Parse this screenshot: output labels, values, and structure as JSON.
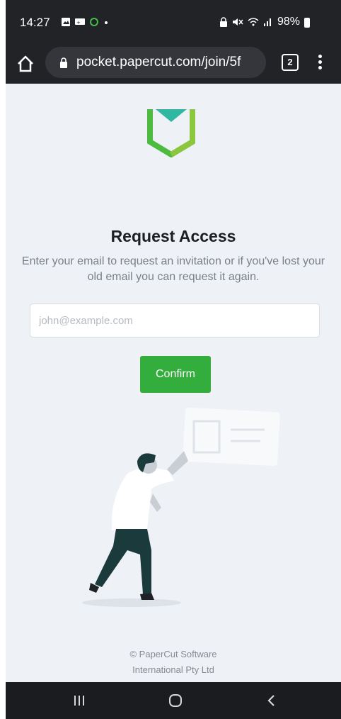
{
  "status_bar": {
    "time": "14:27",
    "battery": "98%",
    "left_icons": [
      "gallery-icon",
      "message-icon",
      "sync-icon",
      "dot-icon"
    ],
    "right_icons": [
      "lock-icon",
      "mute-icon",
      "wifi-icon",
      "signal-icon",
      "battery-icon"
    ]
  },
  "browser": {
    "url": "pocket.papercut.com/join/5f",
    "tab_count": "2"
  },
  "page": {
    "title": "Request Access",
    "subtitle": "Enter your email to request an invitation or if you've lost your old email you can request it again.",
    "email_placeholder": "john@example.com",
    "email_value": "",
    "confirm_label": "Confirm",
    "footer_line1": "© PaperCut Software",
    "footer_line2": "International Pty Ltd"
  },
  "colors": {
    "accent": "#33ad3c",
    "logo_teal": "#2fb7a2",
    "background": "#eef1f5"
  }
}
